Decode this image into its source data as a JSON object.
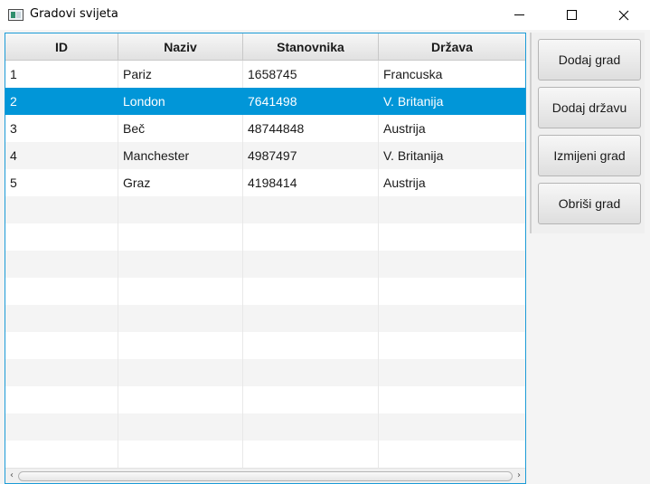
{
  "window": {
    "title": "Gradovi svijeta"
  },
  "table": {
    "columns": [
      "ID",
      "Naziv",
      "Stanovnika",
      "Država"
    ],
    "rows": [
      [
        "1",
        "Pariz",
        "1658745",
        "Francuska"
      ],
      [
        "2",
        "London",
        "7641498",
        "V. Britanija"
      ],
      [
        "3",
        "Beč",
        "48744848",
        "Austrija"
      ],
      [
        "4",
        "Manchester",
        "4987497",
        "V. Britanija"
      ],
      [
        "5",
        "Graz",
        "4198414",
        "Austrija"
      ]
    ],
    "selected_row": 1
  },
  "buttons": {
    "add_city": "Dodaj grad",
    "add_country": "Dodaj državu",
    "edit_city": "Izmijeni grad",
    "delete_city": "Obriši grad"
  },
  "colors": {
    "accent": "#0196d8",
    "focus_border": "#1b9bd7"
  }
}
